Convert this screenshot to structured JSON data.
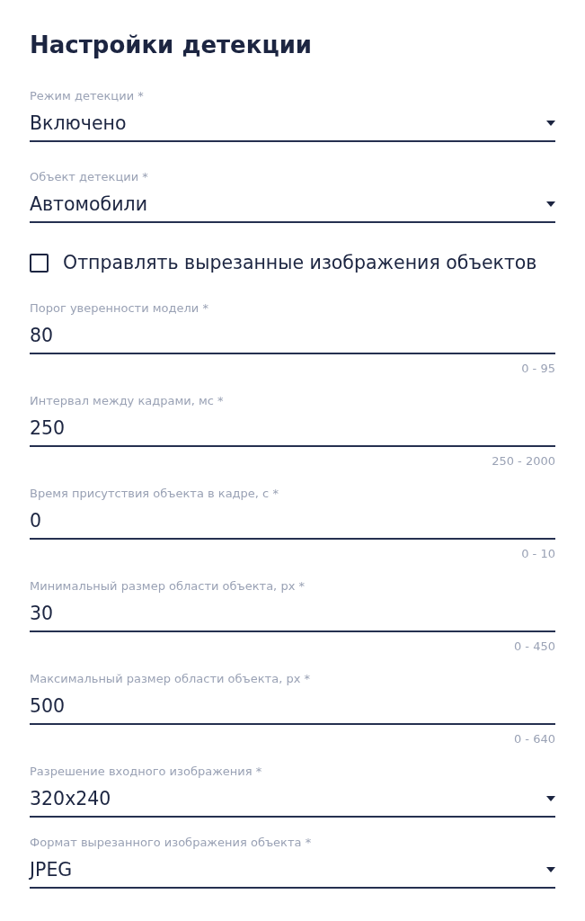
{
  "title": "Настройки детекции",
  "fields": [
    {
      "kind": "select",
      "label": "Режим детекции *",
      "value": "Включено"
    },
    {
      "kind": "select",
      "label": "Объект детекции *",
      "value": "Автомобили"
    },
    {
      "kind": "checkbox",
      "label": "Отправлять вырезанные изображения объектов",
      "checked": false
    },
    {
      "kind": "number",
      "label": "Порог уверенности модели *",
      "value": "80",
      "helper": "0 - 95"
    },
    {
      "kind": "number",
      "label": "Интервал между кадрами, мс *",
      "value": "250",
      "helper": "250 - 2000"
    },
    {
      "kind": "number",
      "label": "Время присутствия объекта в кадре, с *",
      "value": "0",
      "helper": "0 - 10"
    },
    {
      "kind": "number",
      "label": "Минимальный размер области объекта, px *",
      "value": "30",
      "helper": "0 - 450"
    },
    {
      "kind": "number",
      "label": "Максимальный размер области объекта, px *",
      "value": "500",
      "helper": "0 - 640"
    },
    {
      "kind": "select",
      "label": "Разрешение входного изображения *",
      "value": "320x240"
    },
    {
      "kind": "select",
      "label": "Формат вырезанного изображения объекта *",
      "value": "JPEG"
    }
  ]
}
